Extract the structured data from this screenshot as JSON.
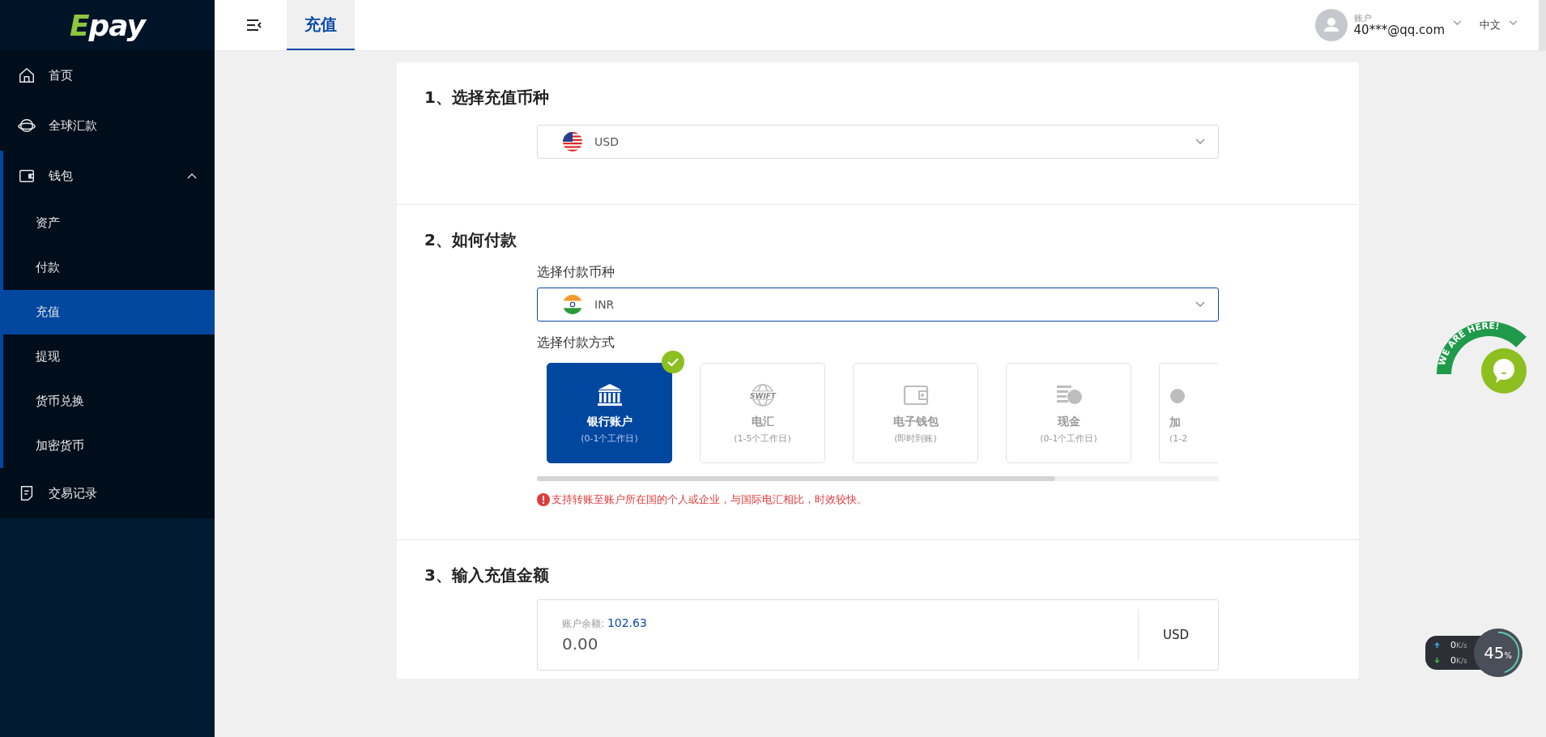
{
  "logo": {
    "accent": "E",
    "rest": "pay"
  },
  "sidebar": {
    "items": [
      {
        "label": "首页",
        "selected": false
      },
      {
        "label": "全球汇款",
        "selected": false
      },
      {
        "label": "钱包",
        "selected": false,
        "expanded": true,
        "children": [
          {
            "label": "资产",
            "selected": false
          },
          {
            "label": "付款",
            "selected": false
          },
          {
            "label": "充值",
            "selected": true
          },
          {
            "label": "提现",
            "selected": false
          },
          {
            "label": "货币兑换",
            "selected": false
          },
          {
            "label": "加密货币",
            "selected": false
          }
        ]
      },
      {
        "label": "交易记录",
        "selected": false
      }
    ]
  },
  "header": {
    "tabs": [
      {
        "label": "充值",
        "selected": true
      }
    ],
    "account": {
      "label": "账户",
      "email": "40***@qq.com"
    },
    "language": "中文"
  },
  "section1": {
    "title": "1、选择充值币种",
    "currency": {
      "value": "USD"
    }
  },
  "section2": {
    "title": "2、如何付款",
    "currency_label": "选择付款币种",
    "currency": {
      "value": "INR"
    },
    "method_label": "选择付款方式",
    "methods": [
      {
        "name": "银行账户",
        "time": "(0-1个工作日)",
        "selected": true
      },
      {
        "icon_text": "SWIFT",
        "name": "电汇",
        "time": "(1-5个工作日)",
        "selected": false
      },
      {
        "name": "电子钱包",
        "time": "(即时到账)",
        "selected": false
      },
      {
        "name": "现金",
        "time": "(0-1个工作日)",
        "selected": false
      },
      {
        "name": "加",
        "time": "(1-2",
        "selected": false
      }
    ],
    "note": "支持转账至账户所在国的个人或企业，与国际电汇相比，时效较快。"
  },
  "section3": {
    "title": "3、输入充值金额",
    "balance_label": "账户余额:",
    "balance": "102.63",
    "amount": "0.00",
    "currency": "USD"
  },
  "chat_widget": {
    "banner": "WE ARE HERE!"
  },
  "speed_widget": {
    "up": "0",
    "up_unit": "K/s",
    "down": "0",
    "down_unit": "K/s",
    "percent": "45",
    "percent_sign": "%",
    "level": 0.45
  }
}
